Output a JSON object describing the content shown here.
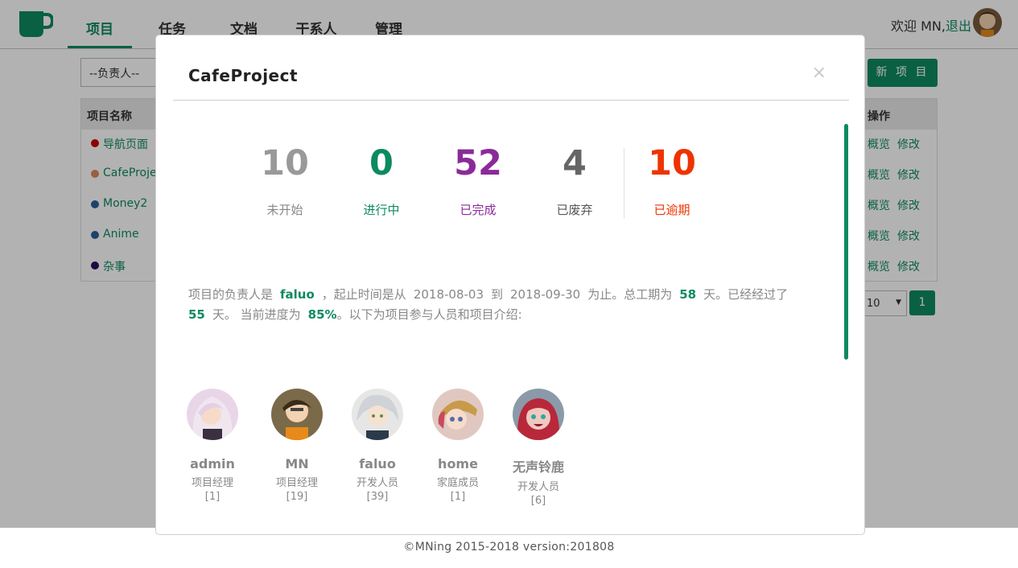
{
  "nav": {
    "tabs": [
      {
        "label": "项目",
        "active": true
      },
      {
        "label": "任务",
        "active": false
      },
      {
        "label": "文档",
        "active": false
      },
      {
        "label": "干系人",
        "active": false
      },
      {
        "label": "管理",
        "active": false
      }
    ],
    "welcome": "欢迎 MN,",
    "logout": "退出"
  },
  "filters": {
    "owner_placeholder": "--负责人--",
    "new_project": "新 项 目"
  },
  "table": {
    "headers": {
      "name": "项目名称",
      "ops": "操作"
    },
    "rows": [
      {
        "name": "导航页面",
        "color": "#cc0000"
      },
      {
        "name": "CafeProje",
        "color": "#d98a5f"
      },
      {
        "name": "Money2",
        "color": "#2d5f9a"
      },
      {
        "name": "Anime",
        "color": "#2d5f9a"
      },
      {
        "name": "杂事",
        "color": "#2a0f5a"
      }
    ],
    "op_overview": "概览",
    "op_edit": "修改"
  },
  "pagination": {
    "page_size": "10",
    "current_page": "1"
  },
  "footer": "©MNing 2015-2018  version:201808",
  "modal": {
    "title": "CafeProject",
    "close": "×",
    "stats": [
      {
        "value": "10",
        "label": "未开始",
        "num_color": "#999999",
        "label_color": "#888888"
      },
      {
        "value": "0",
        "label": "进行中",
        "num_color": "#0d8a5f",
        "label_color": "#0d8a5f"
      },
      {
        "value": "52",
        "label": "已完成",
        "num_color": "#8a2a9a",
        "label_color": "#8a2a9a"
      },
      {
        "value": "4",
        "label": "已废弃",
        "num_color": "#666666",
        "label_color": "#555555"
      },
      {
        "value": "10",
        "label": "已逾期",
        "num_color": "#ee3300",
        "label_color": "#ee3300"
      }
    ],
    "summary": {
      "p1": "项目的负责人是",
      "owner": "faluo",
      "p2": "，起止时间是从",
      "start": "2018-08-03",
      "p3": "到",
      "end": "2018-09-30",
      "p4": "为止。总工期为",
      "total_days": "58",
      "p5": "天。已经经过了",
      "elapsed_days": "55",
      "p6": "天。 当前进度为",
      "progress": "85%",
      "p7": "。以下为项目参与人员和项目介绍:"
    },
    "members": [
      {
        "name": "admin",
        "role": "项目经理",
        "count": "[1]"
      },
      {
        "name": "MN",
        "role": "项目经理",
        "count": "[19]"
      },
      {
        "name": "faluo",
        "role": "开发人员",
        "count": "[39]"
      },
      {
        "name": "home",
        "role": "家庭成员",
        "count": "[1]"
      },
      {
        "name": "无声铃鹿",
        "role": "开发人员",
        "count": "[6]"
      }
    ]
  }
}
